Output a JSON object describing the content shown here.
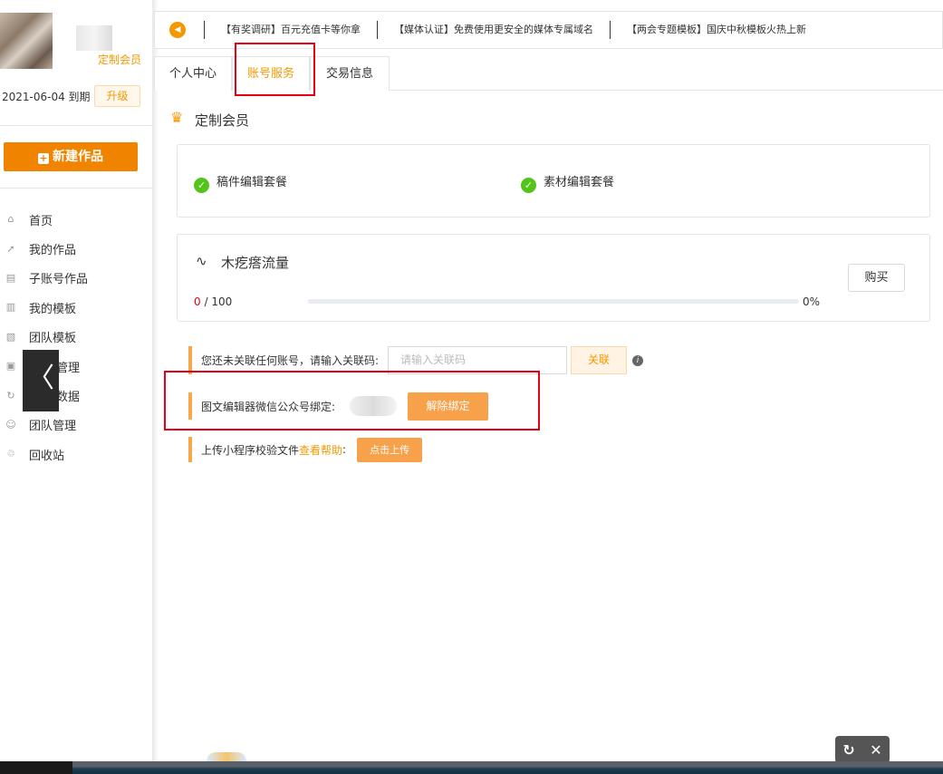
{
  "user": {
    "member_label": "定制会员",
    "expire_text": "2021-06-04 到期",
    "upgrade_label": "升级"
  },
  "sidebar": {
    "new_work_label": "新建作品",
    "items": [
      {
        "label": "首页",
        "icon": "home-icon"
      },
      {
        "label": "我的作品",
        "icon": "rocket-icon"
      },
      {
        "label": "子账号作品",
        "icon": "document-icon"
      },
      {
        "label": "我的模板",
        "icon": "template-icon"
      },
      {
        "label": "团队模板",
        "icon": "team-template-icon"
      },
      {
        "label": "管理",
        "icon": "manage-icon"
      },
      {
        "label": "数据",
        "icon": "sync-icon"
      },
      {
        "label": "团队管理",
        "icon": "team-icon"
      },
      {
        "label": "回收站",
        "icon": "trash-icon"
      }
    ],
    "collapse_glyph": "〈"
  },
  "notices": [
    "【有奖调研】百元充值卡等你拿",
    "【媒体认证】免费使用更安全的媒体专属域名",
    "【两会专题模板】国庆中秋模板火热上新"
  ],
  "tabs": [
    {
      "label": "个人中心",
      "active": false
    },
    {
      "label": "账号服务",
      "active": true
    },
    {
      "label": "交易信息",
      "active": false
    }
  ],
  "membership": {
    "title": "定制会员",
    "packages": [
      "稿件编辑套餐",
      "素材编辑套餐"
    ]
  },
  "traffic": {
    "title": "木疙瘩流量",
    "used": "0",
    "total": "/ 100",
    "percent": "0%",
    "progress": 0,
    "buy_label": "购买"
  },
  "account": {
    "link_prompt": "您还未关联任何账号，请输入关联码:",
    "link_placeholder": "请输入关联码",
    "link_button": "关联",
    "wechat_label": "图文编辑器微信公众号绑定:",
    "unbind_button": "解除绑定",
    "upload_prefix": "上传小程序校验文件",
    "upload_help": "查看帮助",
    "upload_colon": ":",
    "upload_button": "点击上传"
  },
  "colors": {
    "accent": "#f39800",
    "primary_button": "#f08300",
    "success": "#52c41a",
    "highlight_box": "#e60012"
  }
}
